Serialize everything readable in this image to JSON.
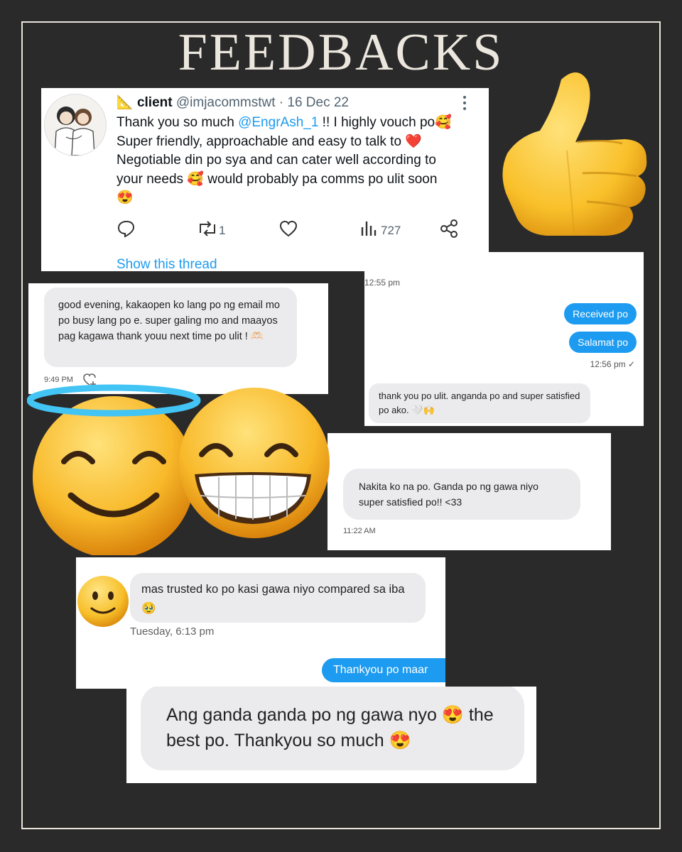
{
  "title": "FEEDBACKS",
  "tweet": {
    "emoji_prefix": "📐",
    "name": "client",
    "handle": "@imjacommstwt",
    "date": "· 16 Dec 22",
    "line1_pre": "Thank you so much ",
    "mention": "@EngrAsh_1",
    "line1_post": " !! I highly vouch po🥰",
    "line2": "Super friendly, approachable and easy to talk to ❤️",
    "line3": "Negotiable din po sya and can cater well according to",
    "line4": "your needs 🥰 would probably pa comms po ulit soon",
    "line5": "😍",
    "retweets": "1",
    "views": "727",
    "show_thread": "Show this thread"
  },
  "msg1": {
    "text": "good evening, kakaopen ko lang po ng email mo po busy lang po e. super galing mo and maayos pag kagawa thank youu next time po ulit ! 🫶🏻",
    "time": "9:49 PM"
  },
  "msg2": {
    "top_time": "12:55 pm",
    "sent1": "Received po",
    "sent2": "Salamat po",
    "sent_time": "12:56 pm ✓",
    "reply": "thank you po ulit. anganda po and super satisfied po ako. 🤍🙌"
  },
  "msg3": {
    "text": "Nakita ko na po. Ganda po ng gawa niyo super satisfied po!! <33",
    "time": "11:22 AM"
  },
  "msg4": {
    "text": "mas trusted ko po kasi gawa niyo compared sa iba 🥹",
    "time": "Tuesday, 6:13 pm",
    "sent": "Thankyou po maar"
  },
  "msg5": {
    "text": "Ang ganda ganda po ng gawa nyo 😍 the best po. Thankyou so much 😍"
  },
  "colors": {
    "background": "#2a2a2a",
    "frame": "#e9e4dc",
    "accent_blue": "#1d9bf0",
    "bubble_gray": "#ebebed"
  },
  "icons": [
    "thumbs-up-icon",
    "halo-smile-emoji-icon",
    "grin-emoji-icon",
    "slight-smile-emoji-icon",
    "reply-icon",
    "retweet-icon",
    "like-icon",
    "views-icon",
    "share-icon",
    "more-icon"
  ]
}
